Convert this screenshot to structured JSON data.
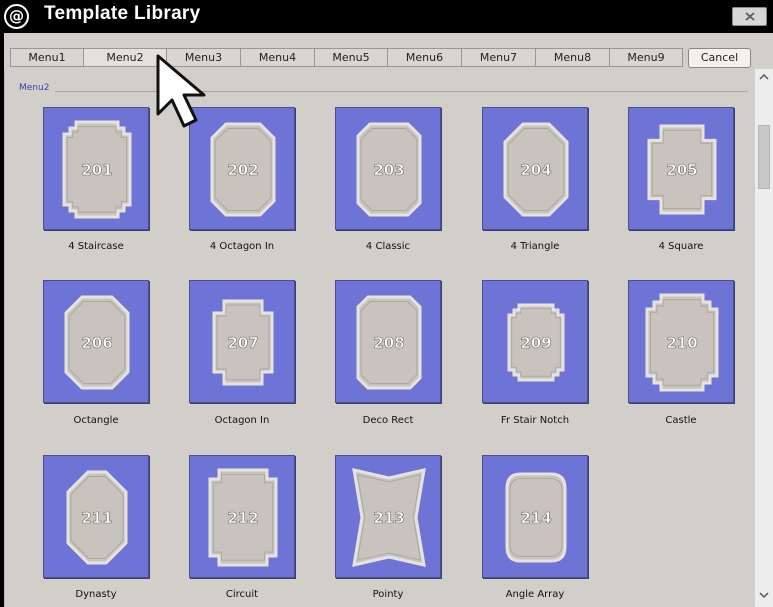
{
  "window": {
    "title": "Template Library",
    "logo_glyph": "@"
  },
  "tabs": [
    "Menu1",
    "Menu2",
    "Menu3",
    "Menu4",
    "Menu5",
    "Menu6",
    "Menu7",
    "Menu8",
    "Menu9"
  ],
  "active_tab_index": 1,
  "cancel_label": "Cancel",
  "group_label": "Menu2",
  "templates": [
    {
      "id": "201",
      "label": "4 Staircase"
    },
    {
      "id": "202",
      "label": "4 Octagon In"
    },
    {
      "id": "203",
      "label": "4 Classic"
    },
    {
      "id": "204",
      "label": "4 Triangle"
    },
    {
      "id": "205",
      "label": "4 Square"
    },
    {
      "id": "206",
      "label": "Octangle"
    },
    {
      "id": "207",
      "label": "Octagon In"
    },
    {
      "id": "208",
      "label": "Deco Rect"
    },
    {
      "id": "209",
      "label": "Fr Stair Notch"
    },
    {
      "id": "210",
      "label": "Castle"
    },
    {
      "id": "211",
      "label": "Dynasty"
    },
    {
      "id": "212",
      "label": "Circuit"
    },
    {
      "id": "213",
      "label": "Pointy"
    },
    {
      "id": "214",
      "label": "Angle Array"
    }
  ],
  "colors": {
    "tile_bg": "#6d74d6",
    "panel_fill": "#c8c4bd",
    "panel_outline": "#e6e3df",
    "background": "#d2cec9",
    "label_accent": "#2b4aa8"
  },
  "icons": {
    "logo": "at-sign-logo-icon",
    "close": "close-x-icon",
    "scroll_up": "chevron-up-icon",
    "scroll_down": "chevron-down-icon",
    "cursor": "mouse-pointer-arrow-icon"
  }
}
